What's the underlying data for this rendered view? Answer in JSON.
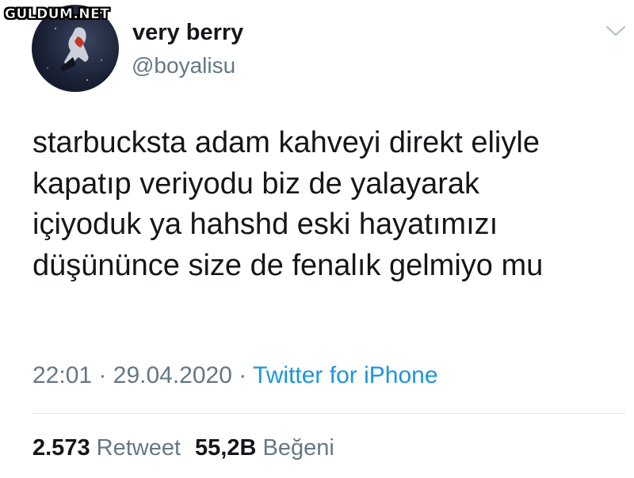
{
  "watermark": "GULDUM.NET",
  "user": {
    "display_name": "very berry",
    "handle": "@boyalisu",
    "avatar_icon": "profile-photo"
  },
  "menu_icon": "chevron-down-icon",
  "tweet": {
    "lines": [
      "starbucksta adam kahveyi direkt eliyle",
      "kapatıp veriyodu biz de yalayarak",
      "içiyoduk ya hahshd eski hayatımızı",
      "düşününce size de fenalık gelmiyo mu"
    ]
  },
  "meta": {
    "time": "22:01",
    "separator": "·",
    "date": "29.04.2020",
    "source": "Twitter for iPhone"
  },
  "stats": {
    "retweet_count": "2.573",
    "retweet_label": "Retweet",
    "like_count": "55,2B",
    "like_label": "Beğeni"
  },
  "colors": {
    "text": "#14171a",
    "secondary": "#657786",
    "link": "#1b95e0",
    "divider": "#dfe3e7"
  }
}
